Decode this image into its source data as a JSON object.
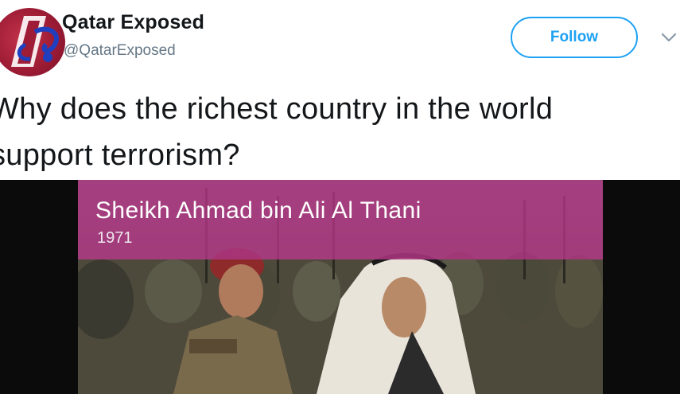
{
  "author": {
    "display_name": "Qatar Exposed",
    "handle": "@QatarExposed",
    "avatar_icon": "qatar-exposed-logo",
    "avatar_color": "#9e1c35"
  },
  "actions": {
    "follow_label": "Follow",
    "follow_color": "#1da1f2",
    "more_icon": "chevron-down-icon"
  },
  "tweet": {
    "text_line1": "Why does the richest country in the world",
    "text_line2": "support terrorism?"
  },
  "video": {
    "caption_title": "Sheikh Ahmad bin Ali Al Thani",
    "caption_year": "1971",
    "caption_color": "#aa347d"
  }
}
